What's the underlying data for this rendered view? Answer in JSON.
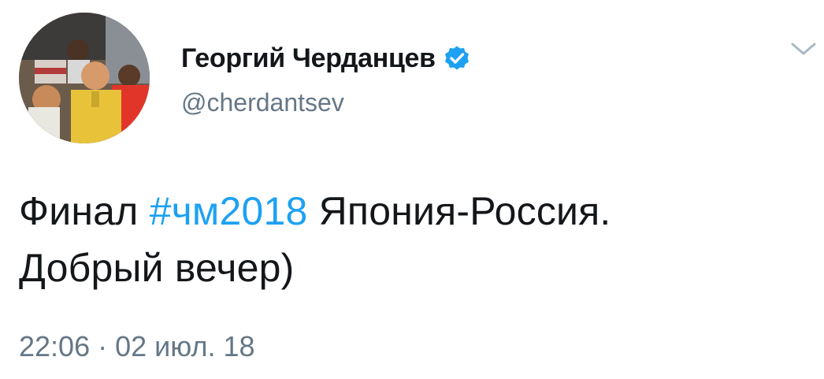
{
  "author": {
    "display_name": "Георгий Черданцев",
    "handle": "@cherdantsev",
    "verified": true,
    "avatar_icon": "profile-photo"
  },
  "menu": {
    "icon": "chevron-down-icon"
  },
  "tweet": {
    "line1_before": "Финал ",
    "hashtag": "#чм2018",
    "line1_after": " Япония-Россия.",
    "line2": "Добрый вечер)"
  },
  "meta": {
    "timestamp": "22:06 · 02 июл. 18"
  },
  "colors": {
    "text": "#14171a",
    "secondary": "#657786",
    "link": "#1da1f2",
    "verified_badge": "#1da1f2"
  }
}
